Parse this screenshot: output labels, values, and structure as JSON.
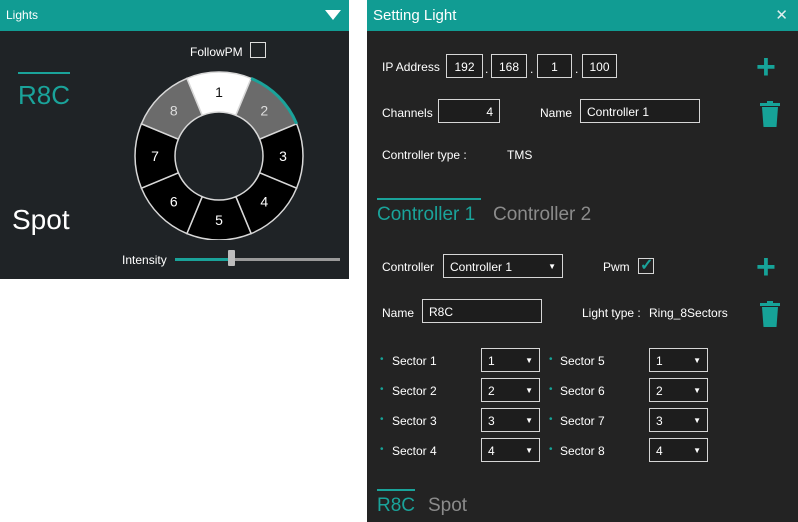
{
  "lights_panel": {
    "title": "Lights",
    "follow_pm_label": "FollowPM",
    "follow_pm_checked": false,
    "light_name": "R8C",
    "light_type": "Spot",
    "intensity_label": "Intensity",
    "intensity_value": 0.34,
    "sectors": [
      "1",
      "2",
      "3",
      "4",
      "5",
      "6",
      "7",
      "8"
    ]
  },
  "setting_panel": {
    "title": "Setting Light",
    "close_icon": "close-icon",
    "ip_label": "IP Address",
    "ip": [
      "192",
      "168",
      "1",
      "100"
    ],
    "ip_dot": ".",
    "channels_label": "Channels",
    "channels_value": "4",
    "name_label": "Name",
    "name_value": "Controller 1",
    "controller_type_label": "Controller type :",
    "controller_type_value": "TMS",
    "controller_tabs": [
      "Controller 1",
      "Controller 2"
    ],
    "controller_label": "Controller",
    "controller_value": "Controller 1",
    "pwm_label": "Pwm",
    "pwm_checked": true,
    "light_name_label": "Name",
    "light_name_value": "R8C",
    "light_type_label": "Light type :",
    "light_type_value": "Ring_8Sectors",
    "sectors_left": [
      {
        "label": "Sector  1",
        "value": "1"
      },
      {
        "label": "Sector  2",
        "value": "2"
      },
      {
        "label": "Sector  3",
        "value": "3"
      },
      {
        "label": "Sector  4",
        "value": "4"
      }
    ],
    "sectors_right": [
      {
        "label": "Sector  5",
        "value": "1"
      },
      {
        "label": "Sector  6",
        "value": "2"
      },
      {
        "label": "Sector  7",
        "value": "3"
      },
      {
        "label": "Sector  8",
        "value": "4"
      }
    ],
    "light_tabs": [
      "R8C",
      "Spot"
    ],
    "accent": "#1aa39a"
  }
}
